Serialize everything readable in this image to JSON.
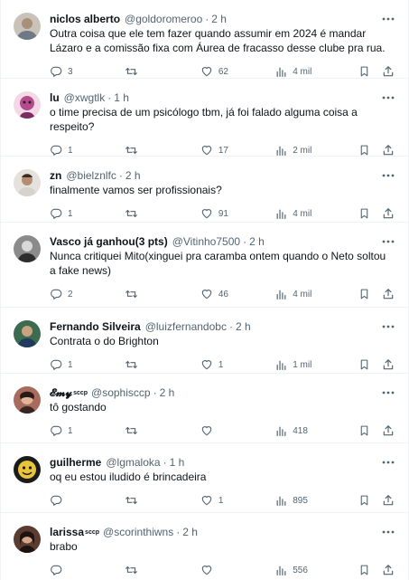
{
  "colors": {
    "text": "#0f1419",
    "muted": "#536471",
    "border": "#eff3f4"
  },
  "icons": {
    "more": "three-dots-icon",
    "reply": "reply-bubble-icon",
    "retweet": "retweet-icon",
    "like": "heart-icon",
    "views": "bar-chart-icon",
    "bookmark": "bookmark-icon",
    "share": "share-upload-icon"
  },
  "tweets": [
    {
      "name": "niclos alberto",
      "badge": "",
      "handle": "@goldoromeroo",
      "time": "2 h",
      "text": "Outra coisa que ele tem fazer quando assumir em 2024 é mandar Lázaro e a comissão fixa com Áurea de fracasso desse clube pra rua.",
      "replies": "3",
      "retweets": "",
      "likes": "62",
      "views": "4 mil"
    },
    {
      "name": "lu",
      "badge": "",
      "handle": "@xwgtlk",
      "time": "1 h",
      "text": "o time precisa de um psicólogo tbm, já foi falado alguma coisa a respeito?",
      "replies": "1",
      "retweets": "",
      "likes": "17",
      "views": "2 mil"
    },
    {
      "name": "zn",
      "badge": "",
      "handle": "@bielznlfc",
      "time": "2 h",
      "text": "finalmente vamos ser profissionais?",
      "replies": "1",
      "retweets": "",
      "likes": "91",
      "views": "4 mil"
    },
    {
      "name": "Vasco já ganhou(3 pts)",
      "badge": "",
      "handle": "@Vitinho7500",
      "time": "2 h",
      "text": "Nunca critiquei Mito(xinguei pra caramba ontem quando o Neto soltou a fake news)",
      "replies": "2",
      "retweets": "",
      "likes": "46",
      "views": "4 mil"
    },
    {
      "name": "Fernando Silveira",
      "badge": "",
      "handle": "@luizfernandobc",
      "time": "2 h",
      "text": "Contrata o do Brighton",
      "replies": "1",
      "retweets": "",
      "likes": "1",
      "views": "1 mil"
    },
    {
      "name": "𝓔𝓶𝔂",
      "badge": "sccp",
      "handle": "@sophisccp",
      "time": "2 h",
      "text": "tô gostando",
      "replies": "1",
      "retweets": "",
      "likes": "",
      "views": "418"
    },
    {
      "name": "guilherme",
      "badge": "",
      "handle": "@lgmaloka",
      "time": "1 h",
      "text": "oq eu estou iludido é brincadeira",
      "replies": "",
      "retweets": "",
      "likes": "1",
      "views": "895"
    },
    {
      "name": "larissa",
      "badge": "sccp",
      "handle": "@scorinthiwns",
      "time": "2 h",
      "text": "brabo",
      "replies": "",
      "retweets": "",
      "likes": "",
      "views": "556"
    }
  ]
}
